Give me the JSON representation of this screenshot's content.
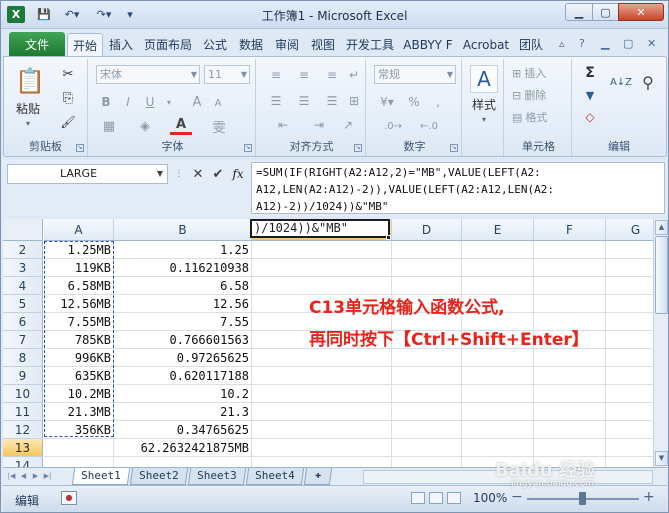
{
  "window": {
    "title": "工作簿1 - Microsoft Excel",
    "app_icon": "X"
  },
  "qat": {
    "save_icon": "💾",
    "undo_icon": "↶▾",
    "redo_icon": "↷▾",
    "customize_icon": "▾"
  },
  "window_controls": {
    "min": "▁",
    "max": "▢",
    "close": "✕"
  },
  "tabs": [
    "文件",
    "开始",
    "插入",
    "页面布局",
    "公式",
    "数据",
    "审阅",
    "视图",
    "开发工具",
    "ABBYY F",
    "Acrobat",
    "团队"
  ],
  "tab_icons": {
    "help": "?",
    "min": "▁",
    "restore": "▢",
    "close": "✕"
  },
  "ribbon": {
    "clipboard": {
      "label": "剪贴板",
      "paste": "粘贴",
      "cut_icon": "✂",
      "copy_icon": "⎘",
      "format_painter_icon": "🖌"
    },
    "font": {
      "label": "字体",
      "font_name": "宋体",
      "font_size": "11",
      "bold": "B",
      "italic": "I",
      "underline": "U",
      "grow": "A",
      "shrink": "A"
    },
    "alignment": {
      "label": "对齐方式"
    },
    "number": {
      "label": "数字",
      "format": "常规"
    },
    "styles": {
      "label": "样式",
      "icon": "A"
    },
    "cells": {
      "label": "单元格",
      "insert": "插入",
      "delete": "删除",
      "format": "格式"
    },
    "editing": {
      "label": "编辑",
      "sum": "Σ",
      "fill": "▼",
      "clear": "◇",
      "sort": "A↓Z",
      "find": "⚲"
    }
  },
  "formula_bar": {
    "name_box": "LARGE",
    "cancel": "✕",
    "enter": "✔",
    "fx": "fx",
    "formula_lines": [
      "=SUM(IF(RIGHT(A2:A12,2)=\"MB\",VALUE(LEFT(A2:",
      "A12,LEN(A2:A12)-2)),VALUE(LEFT(A2:A12,LEN(A2:",
      "A12)-2))/1024))&\"MB\""
    ]
  },
  "grid": {
    "columns": [
      "A",
      "B",
      "C",
      "D",
      "E",
      "F",
      "G"
    ],
    "rows": [
      "2",
      "3",
      "4",
      "5",
      "6",
      "7",
      "8",
      "9",
      "10",
      "11",
      "12",
      "13",
      "14"
    ],
    "col_a": [
      "1.25MB",
      "119KB",
      "6.58MB",
      "12.56MB",
      "7.55MB",
      "785KB",
      "996KB",
      "635KB",
      "10.2MB",
      "21.3MB",
      "356KB"
    ],
    "col_b": [
      "1.25",
      "0.116210938",
      "6.58",
      "12.56",
      "7.55",
      "0.766601563",
      "0.97265625",
      "0.620117188",
      "10.2",
      "21.3",
      "0.34765625"
    ],
    "b13": "62.2632421875MB",
    "c13": ")/1024))&\"MB\""
  },
  "annotation": {
    "line1": "C13单元格输入函数公式,",
    "line2": "再同时按下【Ctrl+Shift+Enter】"
  },
  "sheets": [
    "Sheet1",
    "Sheet2",
    "Sheet3",
    "Sheet4"
  ],
  "status": {
    "mode": "编辑",
    "zoom": "100%",
    "zoom_minus": "−",
    "zoom_plus": "+"
  },
  "watermark": {
    "brand": "Baidu 经验",
    "url": "jingyan.baidu.com"
  },
  "colors": {
    "accent": "#1e7a33",
    "annotation": "#e8231a",
    "selected_header": "#f6c55e"
  }
}
